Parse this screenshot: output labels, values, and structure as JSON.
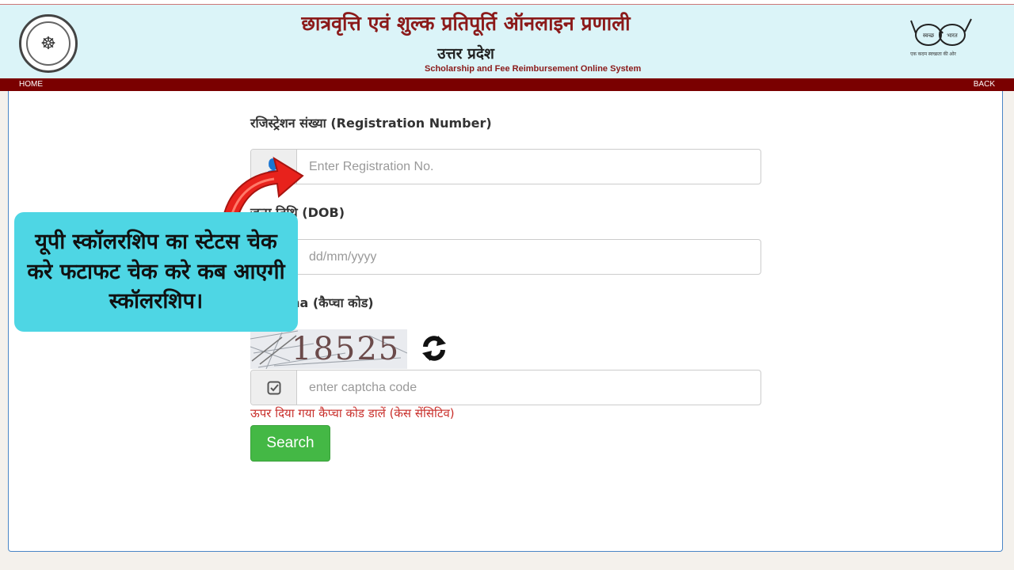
{
  "header": {
    "title_hi": "छात्रवृत्ति एवं शुल्क प्रतिपूर्ति ऑनलाइन प्रणाली",
    "state_hi": "उत्तर प्रदेश",
    "subtitle_en": "Scholarship and Fee Reimbursement Online System",
    "swachh_left": "स्वच्छ",
    "swachh_right": "भारत",
    "swachh_tagline": "एक कदम स्वच्छता की ओर"
  },
  "nav": {
    "home": "HOME",
    "back": "BACK"
  },
  "form": {
    "registration": {
      "label": "रजिस्ट्रेशन संख्या (Registration Number)",
      "placeholder": "Enter Registration No."
    },
    "dob": {
      "label": "जन्म तिथि (DOB)",
      "placeholder": "dd/mm/yyyy"
    },
    "captcha": {
      "label": "Captcha (कैप्चा कोड)",
      "code": "18525",
      "placeholder": "enter captcha code",
      "hint": "ऊपर दिया गया कैप्चा कोड डालें (केस सेंसिटिव)"
    },
    "search_label": "Search"
  },
  "overlay": {
    "callout_text": "यूपी स्कॉलरशिप का स्टेटस चेक करे फटाफट चेक करे कब आएगी स्कॉलरशिप।"
  },
  "colors": {
    "header_bg": "#dbf4f8",
    "nav_bg": "#7a0000",
    "title_color": "#8b1a1a",
    "search_button": "#44b845",
    "callout_bg": "#4ed6e4",
    "arrow": "#e8221c",
    "hint_color": "#c9302c"
  },
  "icons": {
    "emblem": "up-government-emblem",
    "swachh": "swachh-bharat-glasses-logo",
    "captcha_addon": "check-square-icon",
    "refresh": "refresh-icon",
    "pointer": "curved-arrow-icon"
  }
}
